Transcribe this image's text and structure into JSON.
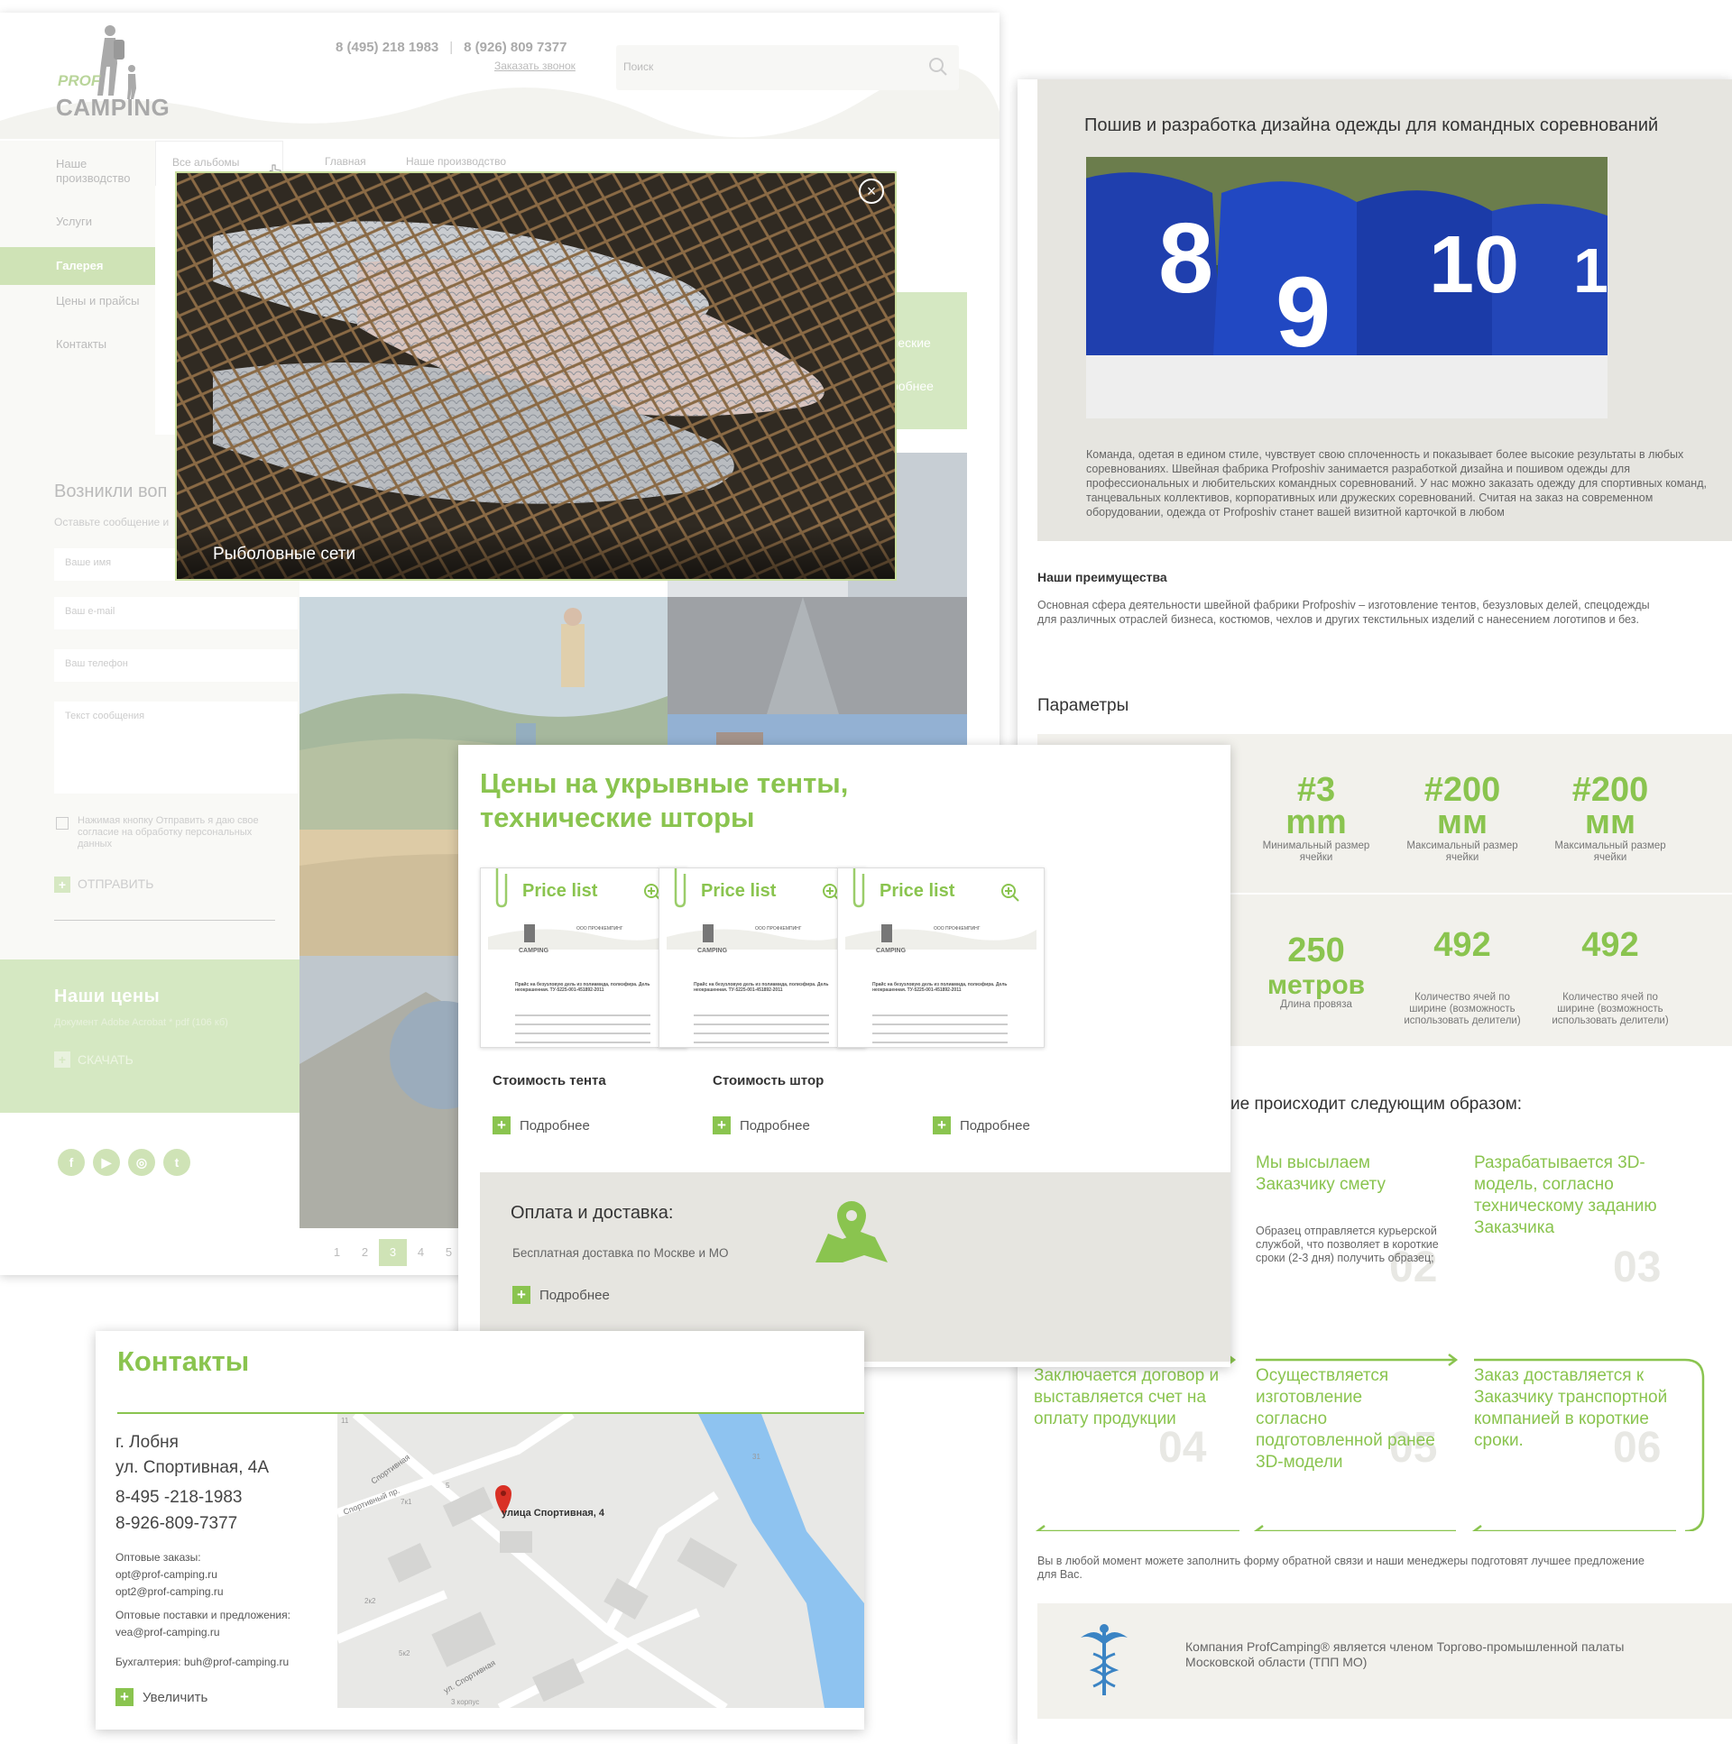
{
  "site": {
    "logo_prof": "PROF",
    "logo_camping": "CAMPING",
    "phone1": "8 (495) 218 1983",
    "phone2": "8 (926) 809 7377",
    "callback": "Заказать звонок",
    "search_placeholder": "Поиск"
  },
  "gallery_page": {
    "nav": [
      "Наше производство",
      "Услуги",
      "Галерея",
      "Цены и прайсы",
      "Контакты"
    ],
    "nav_active": "Галерея",
    "tabs": [
      "Все альбомы",
      "Главная",
      "Наше производство"
    ],
    "green_block": {
      "line1": "ческие",
      "line2": "робнее"
    },
    "form": {
      "heading": "Возникли воп",
      "subheading": "Оставьте сообщение и",
      "name_placeholder": "Ваше имя",
      "email_placeholder": "Ваш e-mail",
      "phone_placeholder": "Ваш телефон",
      "message_placeholder": "Текст сообщения",
      "consent": "Нажимая кнопку Отправить я даю свое согласие на обработку персональных данных",
      "submit": "ОТПРАВИТЬ"
    },
    "prices_block": {
      "title": "Наши  цены",
      "file": "Документ Adobe Acrobat * pdf (106 кб)",
      "download": "СКАЧАТЬ"
    },
    "social": [
      "facebook-icon",
      "youtube-icon",
      "instagram-icon",
      "twitter-icon"
    ],
    "pager": [
      "1",
      "2",
      "3",
      "4",
      "5"
    ],
    "pager_active": "3",
    "lightbox_caption": "Рыболовные сети",
    "lightbox_close": "×"
  },
  "clothing_page": {
    "title": "Пошив и разработка дизайна одежды для командных соревнований",
    "paragraph": "Команда, одетая в едином стиле, чувствует свою сплоченность и показывает более высокие результаты в любых соревнованиях. Швейная фабрика Profposhiv занимается разработкой дизайна и пошивом одежды для профессиональных и любительских командных соревнований. У нас можно заказать одежду для спортивных команд, танцевальных коллективов, корпоративных или дружеских соревнований. Считая на заказ на современном оборудовании, одежда от Profposhiv станет вашей визитной карточкой в любом",
    "adv_heading": "Наши преимущества",
    "adv_text": "Основная сфера деятельности швейной фабрики Profposhiv – изготовление тентов, безузловых делей, спецодежды для различных отраслей бизнеса, костюмов,  чехлов и других текстильных изделий с нанесением логотипов и без.",
    "params_heading": "Параметры",
    "params": [
      {
        "value": "#3",
        "unit": "mm",
        "label": "Минимальный размер ячейки"
      },
      {
        "value": "#200",
        "unit": "мм",
        "label": "Максимальный размер ячейки"
      },
      {
        "value": "#200",
        "unit": "мм",
        "label": "Максимальный размер ячейки"
      },
      {
        "value": "250",
        "unit": "метров",
        "label": "Длина провяза"
      },
      {
        "value": "492",
        "unit": "",
        "label": "Количество ячей по ширине (возможность использовать делители)"
      },
      {
        "value": "492",
        "unit": "",
        "label": "Количество ячей по ширине (возможность использовать делители)"
      }
    ],
    "process_heading": "ие происходит следующим образом:",
    "steps": [
      {
        "num": "02",
        "text": "Мы высылаем Заказчику смету"
      },
      {
        "num": "03",
        "text": "Разрабатывается 3D-модель, согласно техническому заданию Заказчика"
      },
      {
        "num": "04",
        "text": "Заключается договор и выставляется счет на оплату продукции"
      },
      {
        "num": "05",
        "text": "Осуществляется изготовление согласно подготовленной ранее 3D-модели"
      },
      {
        "num": "06",
        "text": "Заказ доставляется к Заказчику транспортной компанией в короткие сроки."
      }
    ],
    "step2_note": "Образец отправляется курьерской службой, что позволяет в короткие сроки (2-3 дня) получить образец;",
    "footnote": "Вы в любой момент можете заполнить форму обратной связи и наши менеджеры подготовят лучшее предложение для Вас.",
    "membership": "Компания ProfCamping® является членом Торгово-промышленной палаты Московской области (ТПП МО)"
  },
  "prices_page": {
    "title_line1": "Цены на укрывные тенты,",
    "title_line2": "технические шторы",
    "cards": [
      {
        "title": "Price list",
        "label": "Стоимость тента",
        "more": "Подробнее"
      },
      {
        "title": "Price list",
        "label": "Стоимость штор",
        "more": "Подробнее"
      },
      {
        "title": "Price list",
        "label": "",
        "more": "Подробнее"
      }
    ],
    "doc_company": "ООО ПРОФКЕМПИНГ",
    "doc_heading": "Прайс на безузловую дель из полиамида, полиэфира. Дель неокрашенная. ТУ-5225-001-451892-2011",
    "payment_title": "Оплата и доставка:",
    "payment_text": "Бесплатная доставка по Москве и МО",
    "payment_more": "Подробнее"
  },
  "contacts_page": {
    "title": "Контакты",
    "city": "г. Лобня",
    "street": "ул. Спортивная, 4А",
    "phone1": "8-495 -218-1983",
    "phone2": "8-926-809-7377",
    "wholesale_label": "Оптовые заказы:",
    "wholesale_email1": "opt@prof-camping.ru",
    "wholesale_email2": "opt2@prof-camping.ru",
    "supply_label": "Оптовые поставки и предложения:",
    "supply_email": "vea@prof-camping.ru",
    "accounting": "Бухгалтерия: buh@prof-camping.ru",
    "zoom": "Увеличить",
    "map_pin_label": "улица Спортивная, 4",
    "map_streets": [
      "Спортивная",
      "Спортивный пр.",
      "ул. Спортивная"
    ],
    "map_labels": [
      "7к1",
      "2к2",
      "5к2",
      "3 корпус",
      "31",
      "11",
      "5"
    ]
  },
  "colors": {
    "accent": "#8ac44f",
    "accent_light": "#d5e8c2",
    "panel_grey": "#e6e5e0",
    "param_bg": "#f2f1ec"
  }
}
